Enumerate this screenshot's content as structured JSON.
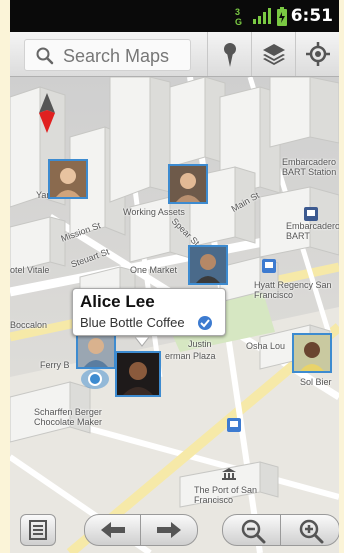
{
  "status": {
    "time": "6:51",
    "network": "3G"
  },
  "search": {
    "placeholder": "Search Maps"
  },
  "toolbar": {
    "icons": [
      "search-icon",
      "place-pin-icon",
      "layers-icon",
      "my-location-icon"
    ]
  },
  "map": {
    "labels": {
      "embarcadero_station": "Embarcadero BART Station",
      "embarcadero_bart": "Embarcadero BART",
      "working_assets": "Working Assets",
      "one_market": "One Market",
      "hotel_vitale": "otel Vitale",
      "hyatt": "Hyatt Regency San Francisco",
      "boccalone": "Boccalon",
      "ferry": "Ferry B",
      "justin": "Justin",
      "herman_plaza": "erman Plaza",
      "osha": "Osha Lou",
      "sol_bier": "Sol Bier",
      "scharffen": "Scharffen Berger Chocolate Maker",
      "port": "The Port of San Francisco",
      "yank": "Yank",
      "mission": "Mission St",
      "steuart": "Steuart St",
      "spear": "Spear St",
      "main": "Main St"
    },
    "bubble": {
      "name": "Alice Lee",
      "place": "Blue Bottle Coffee"
    }
  },
  "bottombar": {
    "icons": [
      "list-icon",
      "back-arrow-icon",
      "forward-arrow-icon",
      "zoom-out-icon",
      "zoom-in-icon"
    ]
  }
}
